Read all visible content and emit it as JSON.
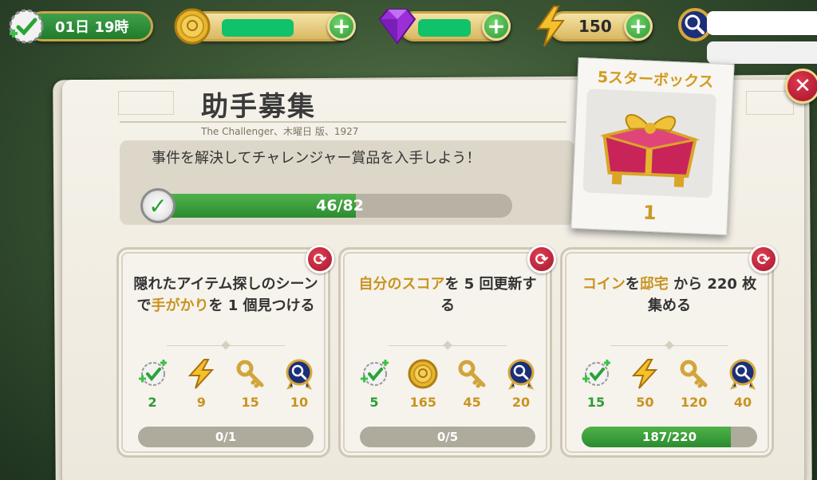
{
  "hud": {
    "timer": "01日 19時",
    "energy": "150"
  },
  "event": {
    "title": "助手募集",
    "subtitle": "The Challenger、木曜日 版、1927",
    "goal_text": "事件を解決してチャレンジャー賞品を入手しよう！",
    "progress_label": "46/82",
    "progress_fraction": 0.561
  },
  "reward": {
    "title": "5スターボックス",
    "count": "1"
  },
  "tasks": [
    {
      "parts": [
        {
          "text": "隠れたアイテム探しのシーンで",
          "hl": false
        },
        {
          "text": "手がかり",
          "hl": true
        },
        {
          "text": "を 1 個見つける",
          "hl": false
        }
      ],
      "rewards": [
        "2",
        "9",
        "15",
        "10"
      ],
      "progress_label": "0/1",
      "progress_fraction": 0
    },
    {
      "parts": [
        {
          "text": "自分のスコア",
          "hl": true
        },
        {
          "text": "を 5 回更新する",
          "hl": false
        }
      ],
      "rewards": [
        "5",
        "165",
        "45",
        "20"
      ],
      "progress_label": "0/5",
      "progress_fraction": 0
    },
    {
      "parts": [
        {
          "text": "コイン",
          "hl": true
        },
        {
          "text": "を",
          "hl": false
        },
        {
          "text": "邸宅",
          "hl": true
        },
        {
          "text": " から 220 枚集める",
          "hl": false
        }
      ],
      "rewards": [
        "15",
        "50",
        "120",
        "40"
      ],
      "progress_label": "187/220",
      "progress_fraction": 0.85
    }
  ],
  "colors": {
    "progress_green": "#2e9a36",
    "highlight_gold": "#c99321",
    "close_red": "#c0203a"
  },
  "icons": [
    "check-plus-icon",
    "coin-icon",
    "gem-icon",
    "lightning-icon",
    "key-icon",
    "magnifier-badge-icon",
    "refresh-icon",
    "close-icon",
    "gift-box-icon"
  ]
}
